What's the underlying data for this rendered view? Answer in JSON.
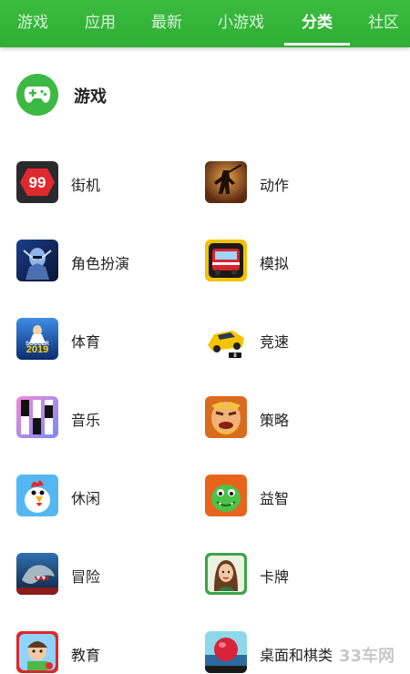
{
  "tabs": [
    {
      "label": "游戏"
    },
    {
      "label": "应用"
    },
    {
      "label": "最新"
    },
    {
      "label": "小游戏"
    },
    {
      "label": "分类",
      "active": true
    },
    {
      "label": "社区"
    }
  ],
  "section": {
    "title": "游戏",
    "icon": "gamepad-icon"
  },
  "categories": [
    {
      "label": "街机",
      "icon": "arcade-99-icon"
    },
    {
      "label": "动作",
      "icon": "action-shadow-fighter-icon"
    },
    {
      "label": "角色扮演",
      "icon": "rpg-armored-hero-icon"
    },
    {
      "label": "模拟",
      "icon": "simulation-bus-icon"
    },
    {
      "label": "体育",
      "icon": "sports-soccer-2019-icon"
    },
    {
      "label": "竞速",
      "icon": "racing-car-icon"
    },
    {
      "label": "音乐",
      "icon": "music-piano-tiles-icon"
    },
    {
      "label": "策略",
      "icon": "strategy-barbarian-icon"
    },
    {
      "label": "休闲",
      "icon": "casual-rooster-icon"
    },
    {
      "label": "益智",
      "icon": "puzzle-green-dino-icon"
    },
    {
      "label": "冒险",
      "icon": "adventure-shark-icon"
    },
    {
      "label": "卡牌",
      "icon": "cards-lady-icon"
    },
    {
      "label": "教育",
      "icon": "education-kid-icon"
    },
    {
      "label": "桌面和棋类",
      "icon": "board-red-ball-icon"
    }
  ],
  "watermark": "33车网",
  "colors": {
    "accent": "#2fae35",
    "text": "#222222"
  }
}
